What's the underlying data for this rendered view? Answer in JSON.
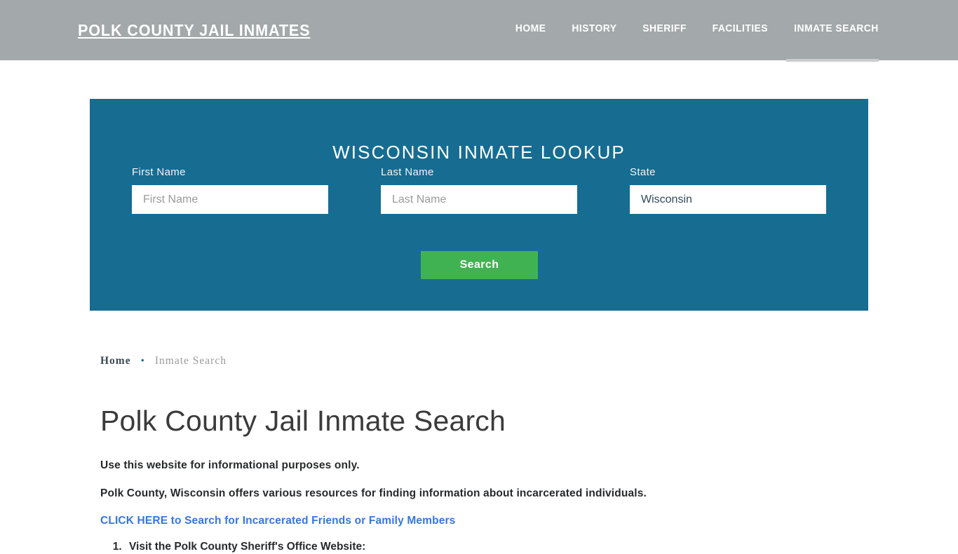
{
  "header": {
    "brand": "POLK COUNTY JAIL INMATES",
    "nav": [
      {
        "label": "HOME",
        "active": false
      },
      {
        "label": "HISTORY",
        "active": false
      },
      {
        "label": "SHERIFF",
        "active": false
      },
      {
        "label": "FACILITIES",
        "active": false
      },
      {
        "label": "INMATE SEARCH",
        "active": true
      }
    ],
    "bg_color": "#a3a8aa"
  },
  "lookup": {
    "title": "WISCONSIN INMATE LOOKUP",
    "panel_color": "#176c91",
    "fields": {
      "first_name": {
        "label": "First Name",
        "placeholder": "First Name",
        "value": ""
      },
      "last_name": {
        "label": "Last Name",
        "placeholder": "Last Name",
        "value": ""
      },
      "state": {
        "label": "State",
        "placeholder": "State",
        "value": "Wisconsin"
      }
    },
    "search_button": {
      "label": "Search",
      "color": "#41b252"
    }
  },
  "breadcrumb": {
    "home": "Home",
    "separator": "•",
    "current": "Inmate Search"
  },
  "main": {
    "title": "Polk County Jail Inmate Search",
    "paragraph_1": "Use this website for informational purposes only.",
    "paragraph_2": "Polk County, Wisconsin offers various resources for finding information about incarcerated individuals.",
    "link": {
      "text": "CLICK HERE to Search for Incarcerated Friends or Family Members",
      "color": "#3576e0"
    },
    "steps": [
      "Visit the Polk County Sheriff's Office Website:"
    ]
  }
}
